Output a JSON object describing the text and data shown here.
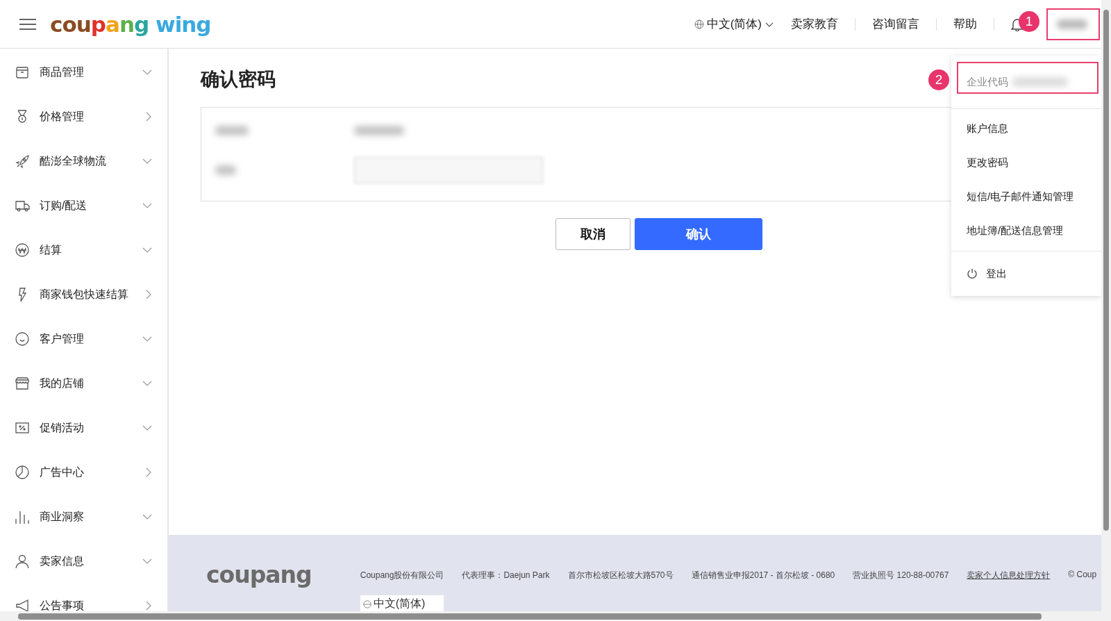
{
  "header": {
    "logo": "coupang wing",
    "language": "中文(简体)",
    "links": [
      "卖家教育",
      "咨询留言",
      "帮助"
    ]
  },
  "sidebar": {
    "items": [
      {
        "label": "商品管理"
      },
      {
        "label": "价格管理"
      },
      {
        "label": "酷澎全球物流"
      },
      {
        "label": "订购/配送"
      },
      {
        "label": "结算"
      },
      {
        "label": "商家钱包快速结算"
      },
      {
        "label": "客户管理"
      },
      {
        "label": "我的店铺"
      },
      {
        "label": "促销活动"
      },
      {
        "label": "广告中心"
      },
      {
        "label": "商业洞察"
      },
      {
        "label": "卖家信息"
      },
      {
        "label": "公告事项"
      }
    ]
  },
  "main": {
    "title": "确认密码",
    "buttons": [
      {
        "label": "取消",
        "kind": "secondary"
      },
      {
        "label": "确认",
        "kind": "primary"
      }
    ]
  },
  "user_menu": {
    "company_code_label": "企业代码",
    "items": [
      "账户信息",
      "更改密码",
      "短信/电子邮件通知管理",
      "地址簿/配送信息管理"
    ],
    "logout": "登出"
  },
  "annotations": [
    {
      "label": "1"
    },
    {
      "label": "2"
    }
  ],
  "footer": {
    "logo": "coupang",
    "items": [
      {
        "text": "Coupang股份有限公司",
        "link": false
      },
      {
        "text": "代表理事：Daejun Park",
        "link": false
      },
      {
        "text": "首尔市松坡区松坡大路570号",
        "link": false
      },
      {
        "text": "通信销售业申报2017 - 首尔松坡 - 0680",
        "link": false
      },
      {
        "text": "营业执照号 120-88-00767",
        "link": false
      },
      {
        "text": "卖家个人信息处理方针",
        "link": true
      },
      {
        "text": "© Coup",
        "link": false
      }
    ],
    "language": "中文(简体)"
  }
}
